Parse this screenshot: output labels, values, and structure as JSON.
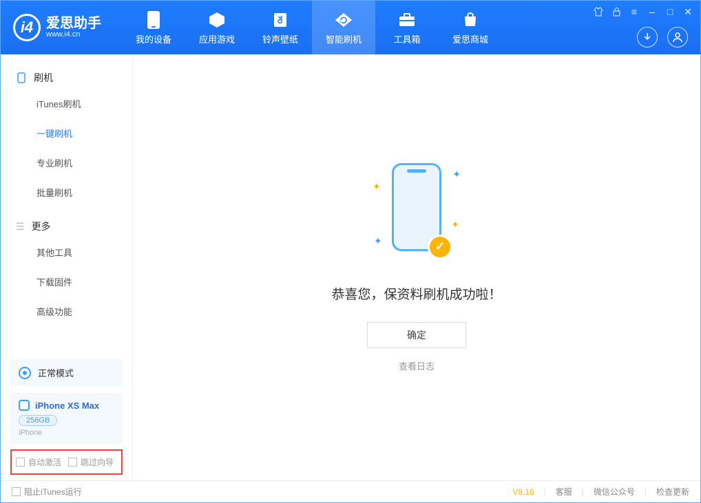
{
  "app": {
    "title": "爱思助手",
    "subtitle": "www.i4.cn"
  },
  "nav": {
    "items": [
      {
        "label": "我的设备",
        "icon": "device"
      },
      {
        "label": "应用游戏",
        "icon": "cube"
      },
      {
        "label": "铃声壁纸",
        "icon": "music"
      },
      {
        "label": "智能刷机",
        "icon": "refresh"
      },
      {
        "label": "工具箱",
        "icon": "toolbox"
      },
      {
        "label": "爱思商城",
        "icon": "bag"
      }
    ]
  },
  "sidebar": {
    "group1": {
      "title": "刷机",
      "items": [
        {
          "label": "iTunes刷机"
        },
        {
          "label": "一键刷机"
        },
        {
          "label": "专业刷机"
        },
        {
          "label": "批量刷机"
        }
      ]
    },
    "group2": {
      "title": "更多",
      "items": [
        {
          "label": "其他工具"
        },
        {
          "label": "下载固件"
        },
        {
          "label": "高级功能"
        }
      ]
    },
    "mode": {
      "label": "正常模式"
    },
    "device": {
      "name": "iPhone XS Max",
      "capacity": "256GB",
      "type": "iPhone"
    },
    "checks": {
      "auto_activate": "自动激活",
      "skip_wizard": "跳过向导"
    }
  },
  "main": {
    "message": "恭喜您，保资料刷机成功啦！",
    "ok_label": "确定",
    "log_link": "查看日志"
  },
  "footer": {
    "block_itunes": "阻止iTunes运行",
    "version": "V8.16",
    "links": {
      "support": "客服",
      "wechat": "微信公众号",
      "update": "检查更新"
    }
  }
}
